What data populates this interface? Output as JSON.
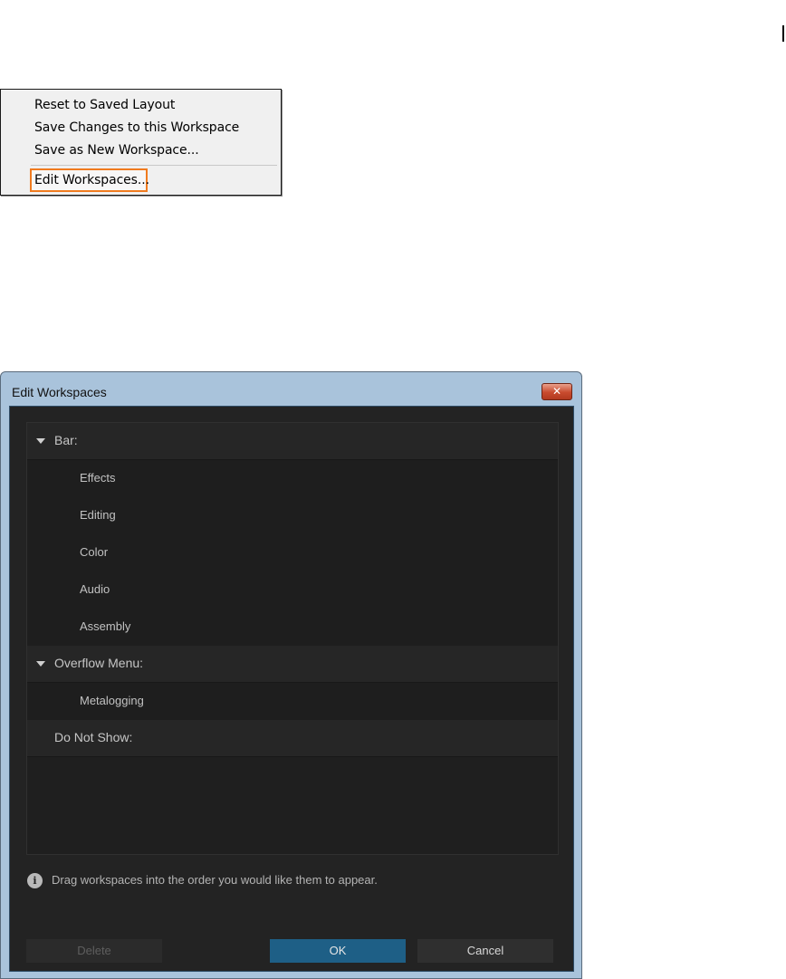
{
  "context_menu": {
    "items": [
      "Reset to Saved Layout",
      "Save Changes to this Workspace",
      "Save as New Workspace...",
      "Edit Workspaces..."
    ],
    "highlight_color": "#f07b1f"
  },
  "dialog": {
    "title": "Edit Workspaces",
    "close_glyph": "✕",
    "groups": [
      {
        "label": "Bar:",
        "expanded": true,
        "items": [
          "Effects",
          "Editing",
          "Color",
          "Audio",
          "Assembly"
        ]
      },
      {
        "label": "Overflow Menu:",
        "expanded": true,
        "items": [
          "Metalogging"
        ]
      },
      {
        "label": "Do Not Show:",
        "expanded": false,
        "items": []
      }
    ],
    "info_text": "Drag workspaces into the order you would like them to appear.",
    "buttons": {
      "delete": "Delete",
      "ok": "OK",
      "cancel": "Cancel"
    },
    "colors": {
      "ok_button": "#1e5f86",
      "panel": "#232323"
    }
  }
}
